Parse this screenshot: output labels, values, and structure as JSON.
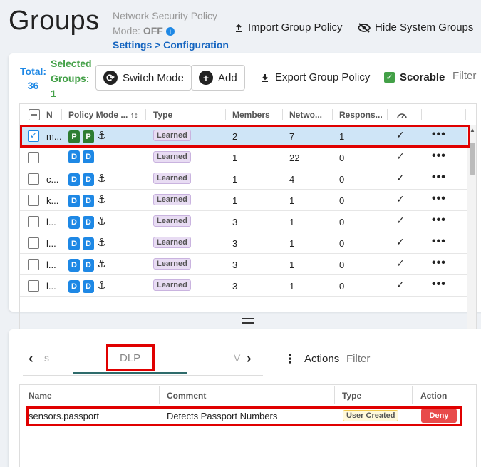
{
  "header": {
    "title": "Groups",
    "policy_line1": "Network Security Policy",
    "policy_mode_label": "Mode:",
    "policy_mode_value": "OFF",
    "breadcrumb": "Settings > Configuration",
    "import_label": "Import Group Policy",
    "hide_label": "Hide System Groups"
  },
  "toolbar": {
    "total_label": "Total:",
    "total_value": "36",
    "selected_label_1": "Selected",
    "selected_label_2": "Groups:",
    "selected_value": "1",
    "switch_mode_label": "Switch Mode",
    "add_label": "Add",
    "export_label": "Export Group Policy",
    "scorable_label": "Scorable",
    "filter_placeholder": "Filter"
  },
  "groups_table": {
    "columns": [
      "N",
      "Policy Mode ...",
      "Type",
      "Members",
      "Netwo...",
      "Respons..."
    ],
    "rows": [
      {
        "name": "m...",
        "badges": [
          "P",
          "P"
        ],
        "anchor": true,
        "type": "Learned",
        "members": "2",
        "network": "7",
        "response": "1",
        "selected": true
      },
      {
        "name": "",
        "badges": [
          "D",
          "D"
        ],
        "anchor": false,
        "type": "Learned",
        "members": "1",
        "network": "22",
        "response": "0",
        "selected": false
      },
      {
        "name": "c...",
        "badges": [
          "D",
          "D"
        ],
        "anchor": true,
        "type": "Learned",
        "members": "1",
        "network": "4",
        "response": "0",
        "selected": false
      },
      {
        "name": "k...",
        "badges": [
          "D",
          "D"
        ],
        "anchor": true,
        "type": "Learned",
        "members": "1",
        "network": "1",
        "response": "0",
        "selected": false
      },
      {
        "name": "l...",
        "badges": [
          "D",
          "D"
        ],
        "anchor": true,
        "type": "Learned",
        "members": "3",
        "network": "1",
        "response": "0",
        "selected": false
      },
      {
        "name": "l...",
        "badges": [
          "D",
          "D"
        ],
        "anchor": true,
        "type": "Learned",
        "members": "3",
        "network": "1",
        "response": "0",
        "selected": false
      },
      {
        "name": "l...",
        "badges": [
          "D",
          "D"
        ],
        "anchor": true,
        "type": "Learned",
        "members": "3",
        "network": "1",
        "response": "0",
        "selected": false
      },
      {
        "name": "l...",
        "badges": [
          "D",
          "D"
        ],
        "anchor": true,
        "type": "Learned",
        "members": "3",
        "network": "1",
        "response": "0",
        "selected": false
      }
    ]
  },
  "bottom": {
    "tab_prev_ghost": "s",
    "tab_active": "DLP",
    "tab_next_ghost": "V",
    "actions_label": "Actions",
    "filter_placeholder": "Filter",
    "columns": [
      "Name",
      "Comment",
      "Type",
      "Action"
    ],
    "rows": [
      {
        "name": "sensors.passport",
        "comment": "Detects Passport Numbers",
        "type": "User Created",
        "action": "Deny"
      }
    ]
  },
  "colors": {
    "accent": "#1e88e5",
    "selected_green": "#43a047",
    "highlight_red": "#e00000",
    "deny_red": "#e84b4b"
  }
}
